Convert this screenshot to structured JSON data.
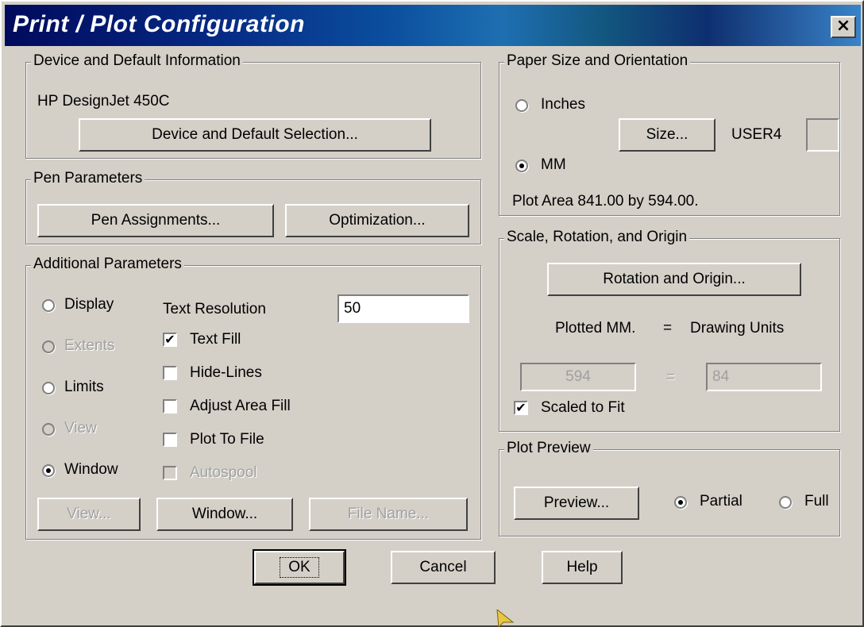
{
  "window": {
    "title": "Print / Plot Configuration",
    "close_glyph": "×"
  },
  "device": {
    "group_label": "Device and Default Information",
    "device_name": "HP DesignJet 450C",
    "selection_button": "Device and Default Selection..."
  },
  "pen": {
    "group_label": "Pen Parameters",
    "assignments_button": "Pen Assignments...",
    "optimization_button": "Optimization..."
  },
  "additional": {
    "group_label": "Additional Parameters",
    "area_options": [
      {
        "label": "Display",
        "selected": false,
        "enabled": true
      },
      {
        "label": "Extents",
        "selected": false,
        "enabled": false
      },
      {
        "label": "Limits",
        "selected": false,
        "enabled": true
      },
      {
        "label": "View",
        "selected": false,
        "enabled": false
      },
      {
        "label": "Window",
        "selected": true,
        "enabled": true
      }
    ],
    "text_resolution_label": "Text Resolution",
    "text_resolution_value": "50",
    "checkboxes": [
      {
        "label": "Text Fill",
        "checked": true,
        "enabled": true
      },
      {
        "label": "Hide-Lines",
        "checked": false,
        "enabled": true
      },
      {
        "label": "Adjust Area Fill",
        "checked": false,
        "enabled": true
      },
      {
        "label": "Plot To File",
        "checked": false,
        "enabled": true
      },
      {
        "label": "Autospool",
        "checked": false,
        "enabled": false
      }
    ],
    "view_button": "View...",
    "window_button": "Window...",
    "file_name_button": "File Name..."
  },
  "paper": {
    "group_label": "Paper Size and Orientation",
    "inches_label": "Inches",
    "mm_label": "MM",
    "units_selected": "MM",
    "size_button": "Size...",
    "size_name": "USER4",
    "plot_area": "Plot Area 841.00 by 594.00."
  },
  "scale": {
    "group_label": "Scale, Rotation, and Origin",
    "rotation_button": "Rotation and Origin...",
    "plotted_label": "Plotted MM.",
    "equals": "=",
    "drawing_units_label": "Drawing Units",
    "plotted_value": "594",
    "drawing_value": "84",
    "scaled_to_fit_label": "Scaled to Fit",
    "scaled_to_fit": true
  },
  "preview": {
    "group_label": "Plot Preview",
    "preview_button": "Preview...",
    "partial_label": "Partial",
    "full_label": "Full",
    "mode_selected": "Partial"
  },
  "footer": {
    "ok_button": "OK",
    "cancel_button": "Cancel",
    "help_button": "Help"
  },
  "icons": {
    "close": "close-icon",
    "radio_dot": "radio-dot-icon",
    "check_mark": "check-mark-icon",
    "cursor": "mouse-cursor-icon"
  },
  "colors": {
    "title_bar": "#062a84",
    "face": "#d4d0c8",
    "disabled_text": "#a0a0a0"
  }
}
